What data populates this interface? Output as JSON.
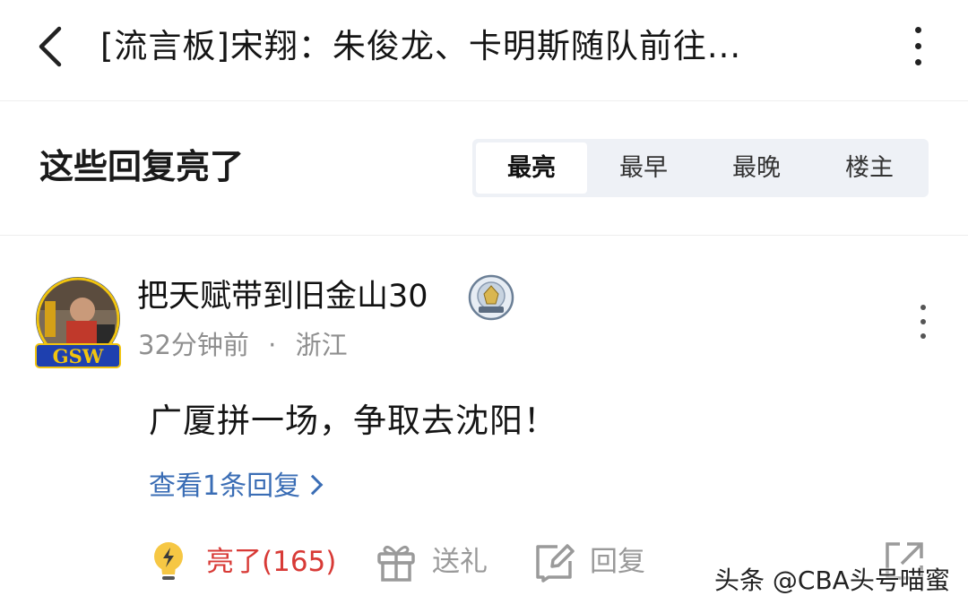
{
  "header": {
    "title": "[流言板]宋翔：朱俊龙、卡明斯随队前往...",
    "back_icon": "back-chevron-icon",
    "more_icon": "vertical-more-icon"
  },
  "replies_section": {
    "title": "这些回复亮了",
    "sort_tabs": [
      {
        "label": "最亮",
        "active": true
      },
      {
        "label": "最早",
        "active": false
      },
      {
        "label": "最晚",
        "active": false
      },
      {
        "label": "楼主",
        "active": false
      }
    ]
  },
  "post": {
    "username": "把天赋带到旧金山30",
    "avatar_text": "GSW",
    "time": "32分钟前",
    "dot": "·",
    "location": "浙江",
    "content": "广厦拼一场，争取去沈阳！",
    "view_replies": "查看1条回复",
    "actions": {
      "like": "亮了(165)",
      "gift": "送礼",
      "reply": "回复"
    }
  },
  "watermark": "头条 @CBA头号喵蜜",
  "colors": {
    "like": "#d83a36",
    "link": "#3a6db5",
    "muted": "#999999",
    "tab_bg": "#eef1f6"
  }
}
